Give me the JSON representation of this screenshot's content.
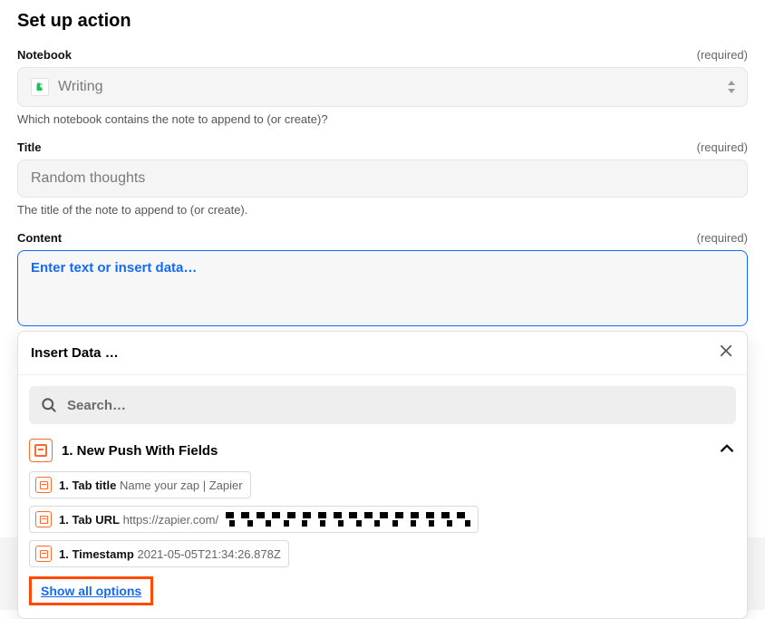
{
  "heading": "Set up action",
  "fields": {
    "notebook": {
      "label": "Notebook",
      "required": "(required)",
      "value": "Writing",
      "help": "Which notebook contains the note to append to (or create)?"
    },
    "title": {
      "label": "Title",
      "required": "(required)",
      "value": "Random thoughts",
      "help": "The title of the note to append to (or create)."
    },
    "content": {
      "label": "Content",
      "required": "(required)",
      "placeholder": "Enter text or insert data…"
    }
  },
  "popover": {
    "title": "Insert Data …",
    "search_placeholder": "Search…",
    "source": {
      "title": "1. New Push With Fields"
    },
    "chips": [
      {
        "key": "1. Tab title",
        "value": "Name your zap | Zapier"
      },
      {
        "key": "1. Tab URL",
        "value": "https://zapier.com/",
        "obscured": true
      },
      {
        "key": "1. Timestamp",
        "value": "2021-05-05T21:34:26.878Z"
      }
    ],
    "show_all": "Show all options"
  }
}
